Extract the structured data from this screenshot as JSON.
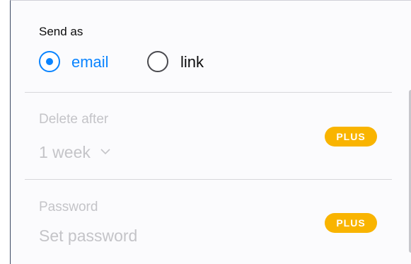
{
  "send_as": {
    "label": "Send as",
    "options": [
      {
        "label": "email",
        "selected": true
      },
      {
        "label": "link",
        "selected": false
      }
    ]
  },
  "delete_after": {
    "label": "Delete after",
    "value": "1 week",
    "badge": "PLUS",
    "icon": "chevron-down-icon"
  },
  "password": {
    "label": "Password",
    "placeholder": "Set password",
    "badge": "PLUS"
  },
  "colors": {
    "accent": "#0a84ff",
    "badge": "#f9b400",
    "disabled_text": "#c4c4c8"
  }
}
